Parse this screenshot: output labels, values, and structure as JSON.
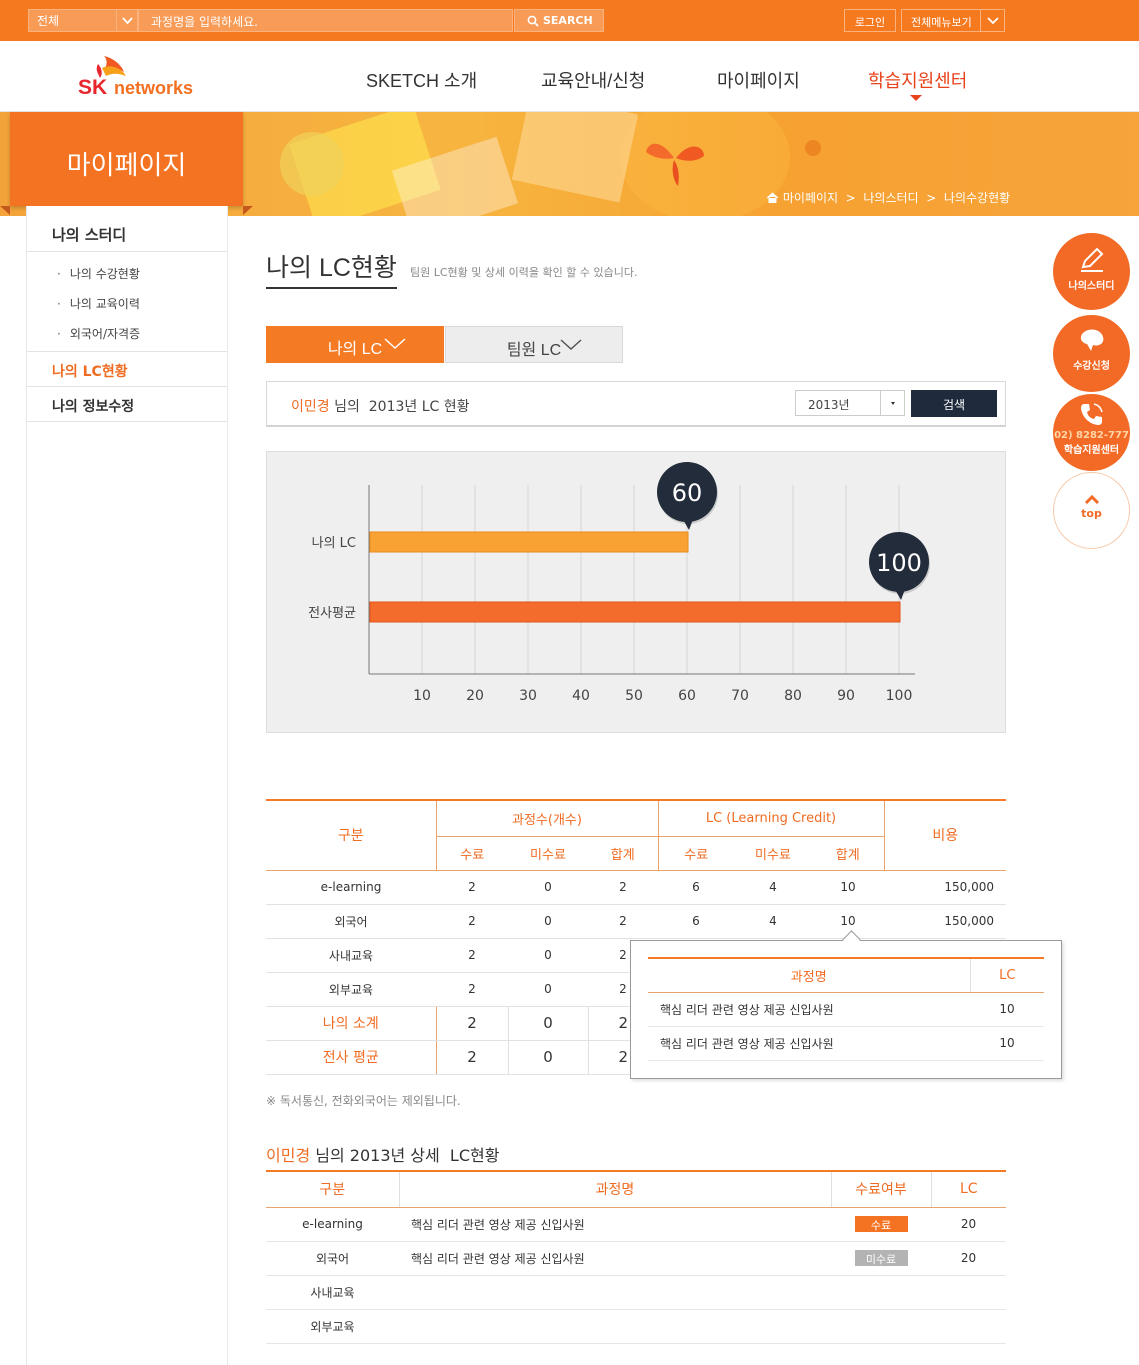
{
  "topbar": {
    "category_select": "전체",
    "search_placeholder": "과정명을 입력하세요.",
    "search_button": "SEARCH",
    "login_button": "로그인",
    "all_menu_button": "전체메뉴보기"
  },
  "gnb": {
    "items": [
      {
        "label": "SKETCH 소개"
      },
      {
        "label": "교육안내/신청"
      },
      {
        "label": "마이페이지"
      },
      {
        "label": "학습지원센터"
      }
    ]
  },
  "logo": {
    "brand": "SK",
    "product": "networks"
  },
  "banner": {
    "section_title": "마이페이지",
    "breadcrumb": [
      "마이페이지",
      "나의스터디",
      "나의수강현황"
    ]
  },
  "sidebar": {
    "my_study": "나의 스터디",
    "sub_items": [
      "나의 수강현황",
      "나의 교육이력",
      "외국어/자격증"
    ],
    "my_lc": "나의 LC현황",
    "my_info": "나의 정보수정"
  },
  "quick_menu": {
    "study": "나의스터디",
    "apply": "수강신청",
    "phone": "02) 8282-777",
    "support": "학습지원센터",
    "top": "top"
  },
  "page": {
    "title": "나의 LC현황",
    "description": "팀원 LC현황 및 상세 이력을 확인 할 수 있습니다."
  },
  "tabs": [
    {
      "label": "나의 LC"
    },
    {
      "label": "팀원 LC"
    }
  ],
  "filter": {
    "user_name": "이민경",
    "suffix": " 님의  2013년 LC 현황",
    "year_value": "2013년",
    "search_button": "검색"
  },
  "chart_data": {
    "type": "bar",
    "orientation": "horizontal",
    "categories": [
      "나의 LC",
      "전사평균"
    ],
    "values": [
      60,
      100
    ],
    "data_labels": [
      "60",
      "100"
    ],
    "x_ticks": [
      "10",
      "20",
      "30",
      "40",
      "50",
      "60",
      "70",
      "80",
      "90",
      "100"
    ],
    "xlim": [
      0,
      100
    ],
    "colors": [
      "#f7a232",
      "#f46c2b"
    ],
    "grid": true
  },
  "summary_table": {
    "headers": {
      "category": "구분",
      "courses": "과정수(개수)",
      "lc": "LC (Learning Credit)",
      "cost": "비용",
      "completed": "수료",
      "incomplete": "미수료",
      "total": "합계"
    },
    "rows": [
      {
        "name": "e-learning",
        "c_done": "2",
        "c_not": "0",
        "c_total": "2",
        "lc_done": "6",
        "lc_not": "4",
        "lc_total": "10",
        "cost": "150,000"
      },
      {
        "name": "외국어",
        "c_done": "2",
        "c_not": "0",
        "c_total": "2",
        "lc_done": "6",
        "lc_not": "4",
        "lc_total": "10",
        "cost": "150,000"
      },
      {
        "name": "사내교육",
        "c_done": "2",
        "c_not": "0",
        "c_total": "2"
      },
      {
        "name": "외부교육",
        "c_done": "2",
        "c_not": "0",
        "c_total": "2"
      }
    ],
    "subtotal_rows": [
      {
        "name": "나의 소계",
        "c_done": "2",
        "c_not": "0",
        "c_total": "2"
      },
      {
        "name": "전사 평균",
        "c_done": "2",
        "c_not": "0",
        "c_total": "2"
      }
    ]
  },
  "popup": {
    "col_course": "과정명",
    "col_lc": "LC",
    "rows": [
      {
        "course": "핵심 리더 관련 영상 제공 신입사원",
        "lc": "10"
      },
      {
        "course": "핵심 리더 관련 영상 제공 신입사원",
        "lc": "10"
      }
    ]
  },
  "note": "※ 독서통신, 전화외국어는 제외됩니다.",
  "detail": {
    "user_name": "이민경",
    "suffix": " 님의 2013년 상세  LC현황",
    "headers": {
      "category": "구분",
      "course": "과정명",
      "status": "수료여부",
      "lc": "LC"
    },
    "rows": [
      {
        "category": "e-learning",
        "course": "핵심 리더 관련 영상 제공 신입사원",
        "status": "수료",
        "lc": "20"
      },
      {
        "category": "외국어",
        "course": "핵심 리더 관련 영상 제공 신입사원",
        "status": "미수료",
        "lc": "20"
      },
      {
        "category": "사내교육",
        "course": "",
        "status": "",
        "lc": ""
      },
      {
        "category": "외부교육",
        "course": "",
        "status": "",
        "lc": ""
      }
    ]
  }
}
